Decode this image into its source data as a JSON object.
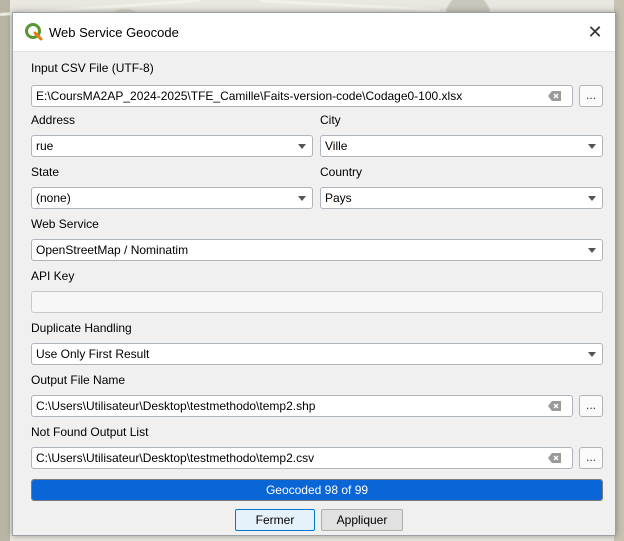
{
  "window": {
    "title": "Web Service Geocode",
    "close_glyph": "✕",
    "icon": "qgis-logo-icon"
  },
  "input_csv": {
    "label": "Input CSV File (UTF-8)",
    "value": "E:\\CoursMA2AP_2024-2025\\TFE_Camille\\Faits-version-code\\Codage0-100.xlsx",
    "browse_label": "..."
  },
  "address": {
    "label": "Address",
    "value": "rue"
  },
  "city": {
    "label": "City",
    "value": "Ville"
  },
  "state": {
    "label": "State",
    "value": "(none)"
  },
  "country": {
    "label": "Country",
    "value": "Pays"
  },
  "web_service": {
    "label": "Web Service",
    "value": "OpenStreetMap / Nominatim"
  },
  "api_key": {
    "label": "API Key",
    "value": ""
  },
  "duplicate_handling": {
    "label": "Duplicate Handling",
    "value": "Use Only First Result"
  },
  "output_file": {
    "label": "Output File Name",
    "value": "C:\\Users\\Utilisateur\\Desktop\\testmethodo\\temp2.shp",
    "browse_label": "..."
  },
  "not_found_output": {
    "label": "Not Found Output List",
    "value": "C:\\Users\\Utilisateur\\Desktop\\testmethodo\\temp2.csv",
    "browse_label": "..."
  },
  "progress": {
    "text": "Geocoded 98 of 99",
    "fraction": 1.0,
    "color": "#0a66d6"
  },
  "buttons": {
    "close_label": "Fermer",
    "apply_label": "Appliquer"
  },
  "colors": {
    "accent": "#0078d7",
    "qgis_green": "#589632",
    "qgis_yellow": "#ee7913"
  }
}
